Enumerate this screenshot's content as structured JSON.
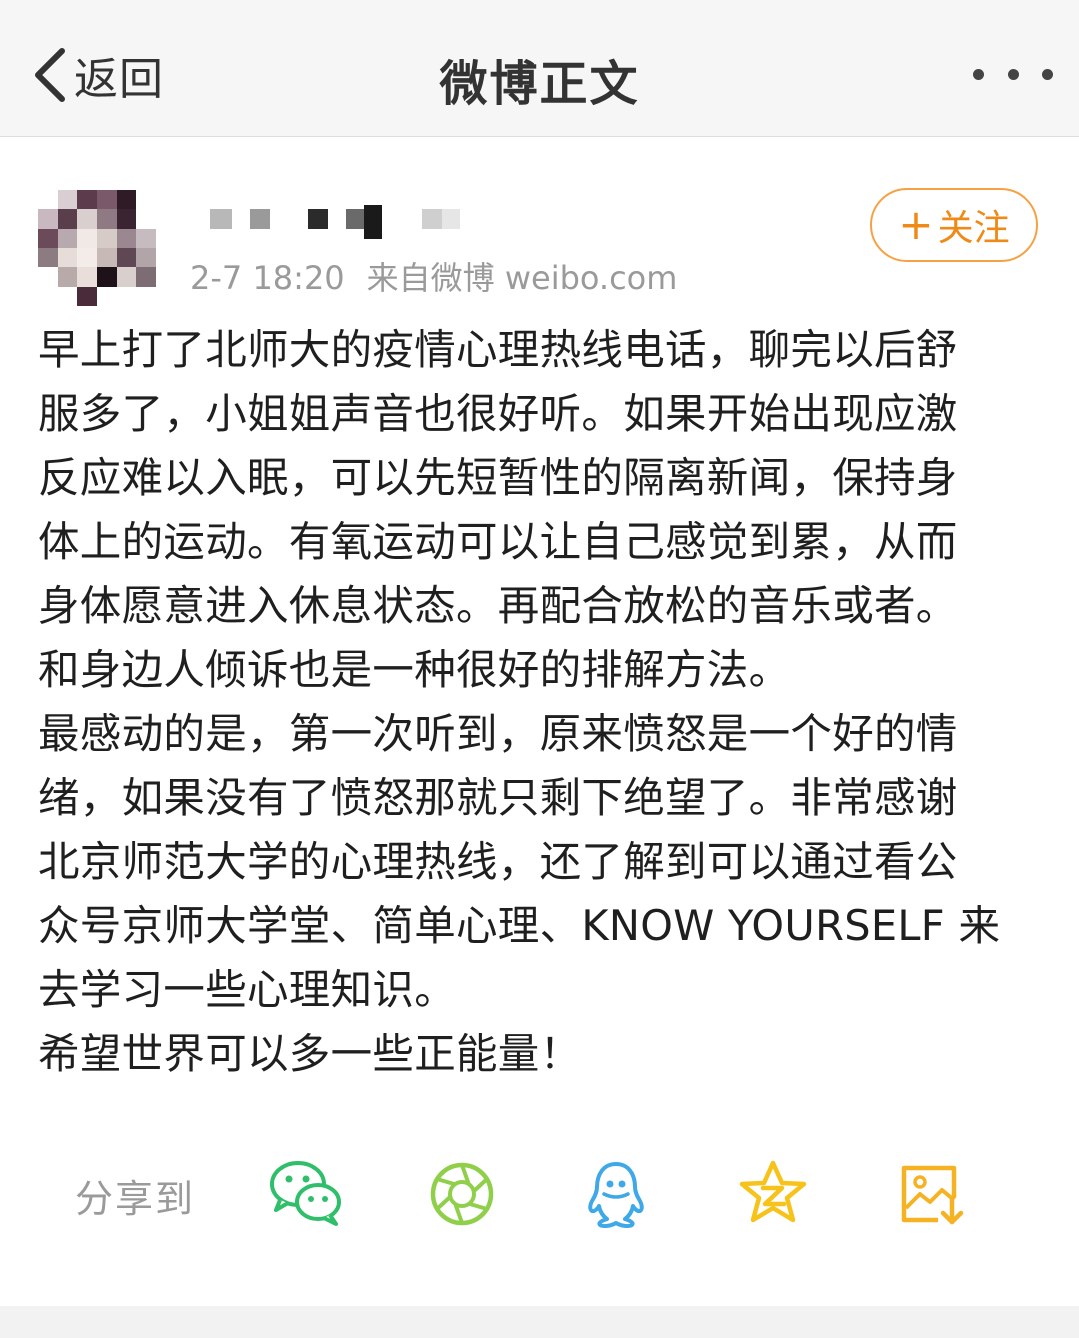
{
  "header": {
    "back_label": "返回",
    "title": "微博正文",
    "back_icon": "chevron-left-icon",
    "more_icon": "more-dots-icon"
  },
  "post": {
    "timestamp": "2-7 18:20",
    "source": "来自微博 weibo.com",
    "follow_label": "关注",
    "follow_icon": "plus-icon",
    "accent_color": "#f08a17",
    "lines": [
      "早上打了北师大的疫情心理热线电话，聊完以后舒",
      "服多了，小姐姐声音也很好听。如果开始出现应激",
      "反应难以入眠，可以先短暂性的隔离新闻，保持身",
      "体上的运动。有氧运动可以让自己感觉到累，从而",
      "身体愿意进入休息状态。再配合放松的音乐或者。",
      "和身边人倾诉也是一种很好的排解方法。",
      "最感动的是，第一次听到，原来愤怒是一个好的情",
      "绪，如果没有了愤怒那就只剩下绝望了。非常感谢",
      "北京师范大学的心理热线，还了解到可以通过看公",
      "众号京师大学堂、简单心理、KNOW YOURSELF 来",
      "去学习一些心理知识。",
      "希望世界可以多一些正能量！"
    ]
  },
  "share": {
    "label": "分享到",
    "targets": [
      {
        "icon": "wechat-icon",
        "color": "#2fbf6b"
      },
      {
        "icon": "moments-icon",
        "color": "#8fcf4a"
      },
      {
        "icon": "qq-icon",
        "color": "#3fa8e8"
      },
      {
        "icon": "qzone-icon",
        "color": "#f7c21a"
      },
      {
        "icon": "save-image-icon",
        "color": "#f5b324"
      }
    ]
  }
}
